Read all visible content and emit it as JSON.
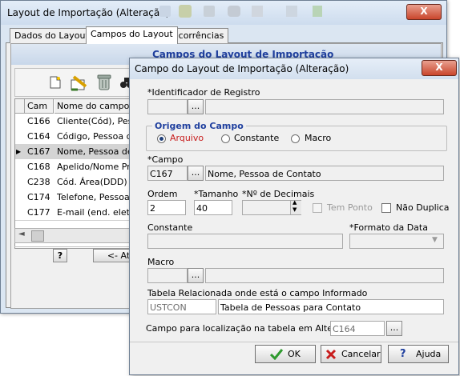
{
  "back_window": {
    "title": "Layout de Importação (Alteração)",
    "close_label": "X",
    "tabs": [
      "Dados do Layout",
      "Campos do Layout",
      "Ocorrências"
    ],
    "panel_header": "Campos do Layout de Importação",
    "grid_headers": [
      "Cam",
      "Nome do campo"
    ],
    "rows": [
      {
        "code": "C166",
        "name": "Cliente(Cód), Pesso"
      },
      {
        "code": "C164",
        "name": "Código, Pessoa de"
      },
      {
        "code": "C167",
        "name": "Nome, Pessoa de C"
      },
      {
        "code": "C168",
        "name": "Apelido/Nome Prefe"
      },
      {
        "code": "C238",
        "name": "Cód. Área(DDD) Te"
      },
      {
        "code": "C174",
        "name": "Telefone, Pessoa d"
      },
      {
        "code": "C177",
        "name": "E-mail (end. eletrôn"
      }
    ],
    "selected_row": 2,
    "nav_button": "<- At",
    "help_glyph": "?"
  },
  "dialog": {
    "title": "Campo do Layout de Importação (Alteração)",
    "close_label": "X",
    "identificador_label": "*Identificador de Registro",
    "identificador_value": "",
    "identificador_desc": "",
    "origem_label": "Origem do Campo",
    "origem_options": [
      "Arquivo",
      "Constante",
      "Macro"
    ],
    "origem_selected": "Arquivo",
    "campo_label": "*Campo",
    "campo_code": "C167",
    "campo_desc": "Nome, Pessoa de Contato",
    "ordem_label": "Ordem",
    "ordem_value": "2",
    "tamanho_label": "*Tamanho",
    "tamanho_value": "40",
    "decimais_label": "*Nº de Decimais",
    "decimais_value": "",
    "tem_ponto_label": "Tem Ponto",
    "nao_duplica_label": "Não Duplica",
    "constante_label": "Constante",
    "constante_value": "",
    "formato_label": "*Formato da Data",
    "formato_value": "",
    "macro_label": "Macro",
    "macro_value": "",
    "macro_desc": "",
    "tabela_label": "Tabela Relacionada onde está o campo Informado",
    "tabela_code": "USTCON",
    "tabela_desc": "Tabela de Pessoas para Contato",
    "loc_label": "Campo para localização na tabela em Alteração",
    "loc_value": "C164",
    "ellipsis": "...",
    "ok_label": "OK",
    "cancel_label": "Cancelar",
    "help_label": "Ajuda"
  },
  "colors": {
    "accent_blue": "#1f3f9e",
    "ok_green": "#2e9a2e",
    "cancel_red": "#c81d1d"
  }
}
